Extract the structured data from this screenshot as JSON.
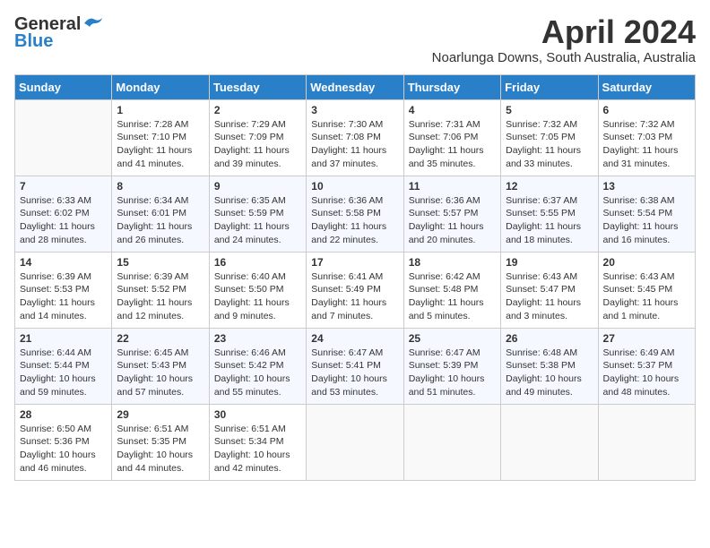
{
  "header": {
    "logo_line1": "General",
    "logo_line2": "Blue",
    "month_title": "April 2024",
    "subtitle": "Noarlunga Downs, South Australia, Australia"
  },
  "weekdays": [
    "Sunday",
    "Monday",
    "Tuesday",
    "Wednesday",
    "Thursday",
    "Friday",
    "Saturday"
  ],
  "weeks": [
    [
      {
        "day": "",
        "info": ""
      },
      {
        "day": "1",
        "info": "Sunrise: 7:28 AM\nSunset: 7:10 PM\nDaylight: 11 hours\nand 41 minutes."
      },
      {
        "day": "2",
        "info": "Sunrise: 7:29 AM\nSunset: 7:09 PM\nDaylight: 11 hours\nand 39 minutes."
      },
      {
        "day": "3",
        "info": "Sunrise: 7:30 AM\nSunset: 7:08 PM\nDaylight: 11 hours\nand 37 minutes."
      },
      {
        "day": "4",
        "info": "Sunrise: 7:31 AM\nSunset: 7:06 PM\nDaylight: 11 hours\nand 35 minutes."
      },
      {
        "day": "5",
        "info": "Sunrise: 7:32 AM\nSunset: 7:05 PM\nDaylight: 11 hours\nand 33 minutes."
      },
      {
        "day": "6",
        "info": "Sunrise: 7:32 AM\nSunset: 7:03 PM\nDaylight: 11 hours\nand 31 minutes."
      }
    ],
    [
      {
        "day": "7",
        "info": "Sunrise: 6:33 AM\nSunset: 6:02 PM\nDaylight: 11 hours\nand 28 minutes."
      },
      {
        "day": "8",
        "info": "Sunrise: 6:34 AM\nSunset: 6:01 PM\nDaylight: 11 hours\nand 26 minutes."
      },
      {
        "day": "9",
        "info": "Sunrise: 6:35 AM\nSunset: 5:59 PM\nDaylight: 11 hours\nand 24 minutes."
      },
      {
        "day": "10",
        "info": "Sunrise: 6:36 AM\nSunset: 5:58 PM\nDaylight: 11 hours\nand 22 minutes."
      },
      {
        "day": "11",
        "info": "Sunrise: 6:36 AM\nSunset: 5:57 PM\nDaylight: 11 hours\nand 20 minutes."
      },
      {
        "day": "12",
        "info": "Sunrise: 6:37 AM\nSunset: 5:55 PM\nDaylight: 11 hours\nand 18 minutes."
      },
      {
        "day": "13",
        "info": "Sunrise: 6:38 AM\nSunset: 5:54 PM\nDaylight: 11 hours\nand 16 minutes."
      }
    ],
    [
      {
        "day": "14",
        "info": "Sunrise: 6:39 AM\nSunset: 5:53 PM\nDaylight: 11 hours\nand 14 minutes."
      },
      {
        "day": "15",
        "info": "Sunrise: 6:39 AM\nSunset: 5:52 PM\nDaylight: 11 hours\nand 12 minutes."
      },
      {
        "day": "16",
        "info": "Sunrise: 6:40 AM\nSunset: 5:50 PM\nDaylight: 11 hours\nand 9 minutes."
      },
      {
        "day": "17",
        "info": "Sunrise: 6:41 AM\nSunset: 5:49 PM\nDaylight: 11 hours\nand 7 minutes."
      },
      {
        "day": "18",
        "info": "Sunrise: 6:42 AM\nSunset: 5:48 PM\nDaylight: 11 hours\nand 5 minutes."
      },
      {
        "day": "19",
        "info": "Sunrise: 6:43 AM\nSunset: 5:47 PM\nDaylight: 11 hours\nand 3 minutes."
      },
      {
        "day": "20",
        "info": "Sunrise: 6:43 AM\nSunset: 5:45 PM\nDaylight: 11 hours\nand 1 minute."
      }
    ],
    [
      {
        "day": "21",
        "info": "Sunrise: 6:44 AM\nSunset: 5:44 PM\nDaylight: 10 hours\nand 59 minutes."
      },
      {
        "day": "22",
        "info": "Sunrise: 6:45 AM\nSunset: 5:43 PM\nDaylight: 10 hours\nand 57 minutes."
      },
      {
        "day": "23",
        "info": "Sunrise: 6:46 AM\nSunset: 5:42 PM\nDaylight: 10 hours\nand 55 minutes."
      },
      {
        "day": "24",
        "info": "Sunrise: 6:47 AM\nSunset: 5:41 PM\nDaylight: 10 hours\nand 53 minutes."
      },
      {
        "day": "25",
        "info": "Sunrise: 6:47 AM\nSunset: 5:39 PM\nDaylight: 10 hours\nand 51 minutes."
      },
      {
        "day": "26",
        "info": "Sunrise: 6:48 AM\nSunset: 5:38 PM\nDaylight: 10 hours\nand 49 minutes."
      },
      {
        "day": "27",
        "info": "Sunrise: 6:49 AM\nSunset: 5:37 PM\nDaylight: 10 hours\nand 48 minutes."
      }
    ],
    [
      {
        "day": "28",
        "info": "Sunrise: 6:50 AM\nSunset: 5:36 PM\nDaylight: 10 hours\nand 46 minutes."
      },
      {
        "day": "29",
        "info": "Sunrise: 6:51 AM\nSunset: 5:35 PM\nDaylight: 10 hours\nand 44 minutes."
      },
      {
        "day": "30",
        "info": "Sunrise: 6:51 AM\nSunset: 5:34 PM\nDaylight: 10 hours\nand 42 minutes."
      },
      {
        "day": "",
        "info": ""
      },
      {
        "day": "",
        "info": ""
      },
      {
        "day": "",
        "info": ""
      },
      {
        "day": "",
        "info": ""
      }
    ]
  ]
}
